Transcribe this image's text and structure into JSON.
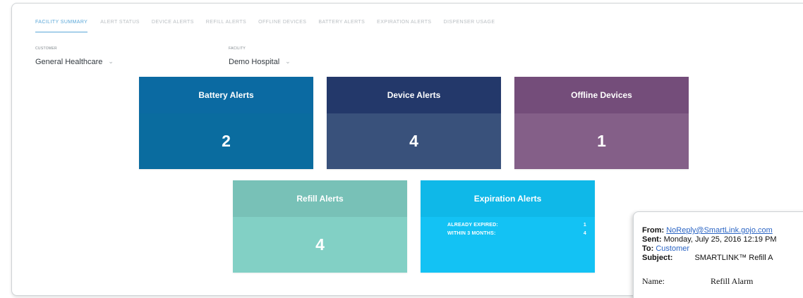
{
  "tabs": [
    {
      "label": "FACILITY SUMMARY",
      "active": true
    },
    {
      "label": "ALERT STATUS",
      "active": false
    },
    {
      "label": "DEVICE ALERTS",
      "active": false
    },
    {
      "label": "REFILL ALERTS",
      "active": false
    },
    {
      "label": "OFFLINE DEVICES",
      "active": false
    },
    {
      "label": "BATTERY ALERTS",
      "active": false
    },
    {
      "label": "EXPIRATION ALERTS",
      "active": false
    },
    {
      "label": "DISPENSER USAGE",
      "active": false
    }
  ],
  "filters": {
    "customer": {
      "label": "CUSTOMER",
      "value": "General Healthcare"
    },
    "facility": {
      "label": "FACILITY",
      "value": "Demo Hospital"
    }
  },
  "tiles": {
    "battery": {
      "title": "Battery Alerts",
      "value": "2"
    },
    "device": {
      "title": "Device Alerts",
      "value": "4"
    },
    "offline": {
      "title": "Offline Devices",
      "value": "1"
    },
    "refill": {
      "title": "Refill Alerts",
      "value": "4"
    },
    "expiration": {
      "title": "Expiration Alerts",
      "rows": [
        {
          "label": "ALREADY EXPIRED:",
          "value": "1"
        },
        {
          "label": "WITHIN 3 MONTHS:",
          "value": "4"
        }
      ]
    }
  },
  "email": {
    "from_label": "From:",
    "from_value": "NoReply@SmartLink.gojo.com",
    "sent_label": "Sent:",
    "sent_value": "Monday, July 25, 2016 12:19 PM",
    "to_label": "To:",
    "to_value": "Customer",
    "subject_label": "Subject:",
    "subject_value": "SMARTLINK™ Refill A",
    "name_label": "Name:",
    "name_value": "Refill Alarm"
  },
  "colors": {
    "battery": "#0a6c9f",
    "device": "#39517b",
    "offline": "#845f88",
    "refill": "#82d0c5",
    "expiration": "#13c2f4",
    "active_tab": "#5aa7d8"
  },
  "icons": {
    "dropdown": "chevron-down-icon"
  }
}
